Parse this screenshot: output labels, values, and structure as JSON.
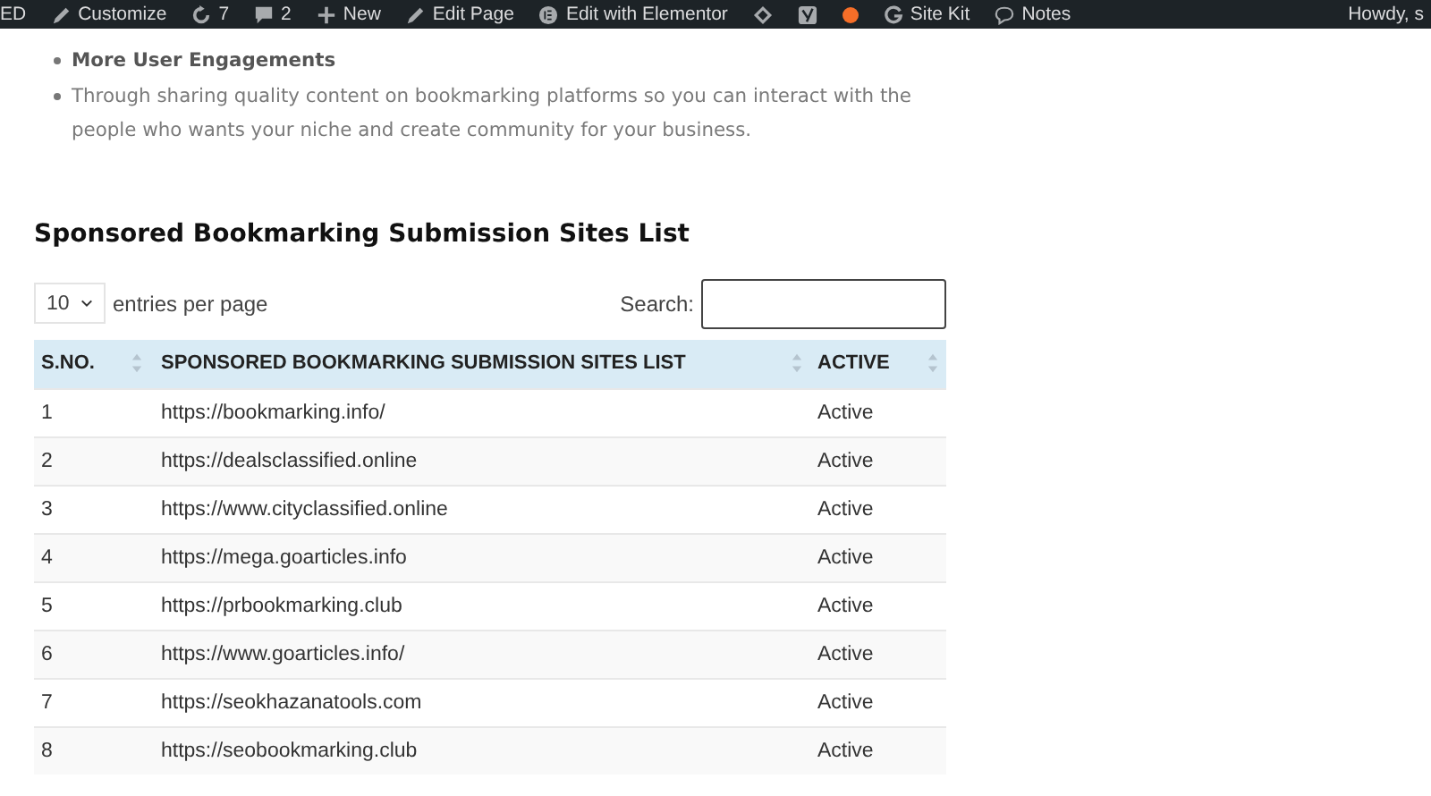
{
  "admin_bar": {
    "items": [
      {
        "kind": "text",
        "label": "ED"
      },
      {
        "kind": "pencil",
        "label": "Customize"
      },
      {
        "kind": "refresh",
        "label": "7"
      },
      {
        "kind": "comment",
        "label": "2"
      },
      {
        "kind": "plus",
        "label": "New"
      },
      {
        "kind": "pencil",
        "label": "Edit Page"
      },
      {
        "kind": "elementor",
        "label": "Edit with Elementor"
      },
      {
        "kind": "diamond"
      },
      {
        "kind": "yoast"
      },
      {
        "kind": "dot"
      },
      {
        "kind": "google",
        "label": "Site Kit"
      },
      {
        "kind": "bubble",
        "label": "Notes"
      }
    ],
    "greeting": "Howdy, s"
  },
  "bullets": [
    {
      "text": "More User Engagements",
      "bold": true
    },
    {
      "text": "Through sharing quality content on bookmarking platforms so you can interact with the people who wants your niche and create community for your business.",
      "bold": false
    }
  ],
  "heading": "Sponsored Bookmarking Submission Sites List",
  "length_select": {
    "value": "10",
    "label": "entries per page"
  },
  "search": {
    "label": "Search:"
  },
  "table": {
    "columns": [
      "S.NO.",
      "SPONSORED BOOKMARKING SUBMISSION SITES LIST",
      "ACTIVE"
    ],
    "rows": [
      [
        "1",
        "https://bookmarking.info/",
        "Active"
      ],
      [
        "2",
        "https://dealsclassified.online",
        "Active"
      ],
      [
        "3",
        "https://www.cityclassified.online",
        "Active"
      ],
      [
        "4",
        "https://mega.goarticles.info",
        "Active"
      ],
      [
        "5",
        "https://prbookmarking.club",
        "Active"
      ],
      [
        "6",
        "https://www.goarticles.info/",
        "Active"
      ],
      [
        "7",
        "https://seokhazanatools.com",
        "Active"
      ],
      [
        "8",
        "https://seobookmarking.club",
        "Active"
      ]
    ]
  }
}
